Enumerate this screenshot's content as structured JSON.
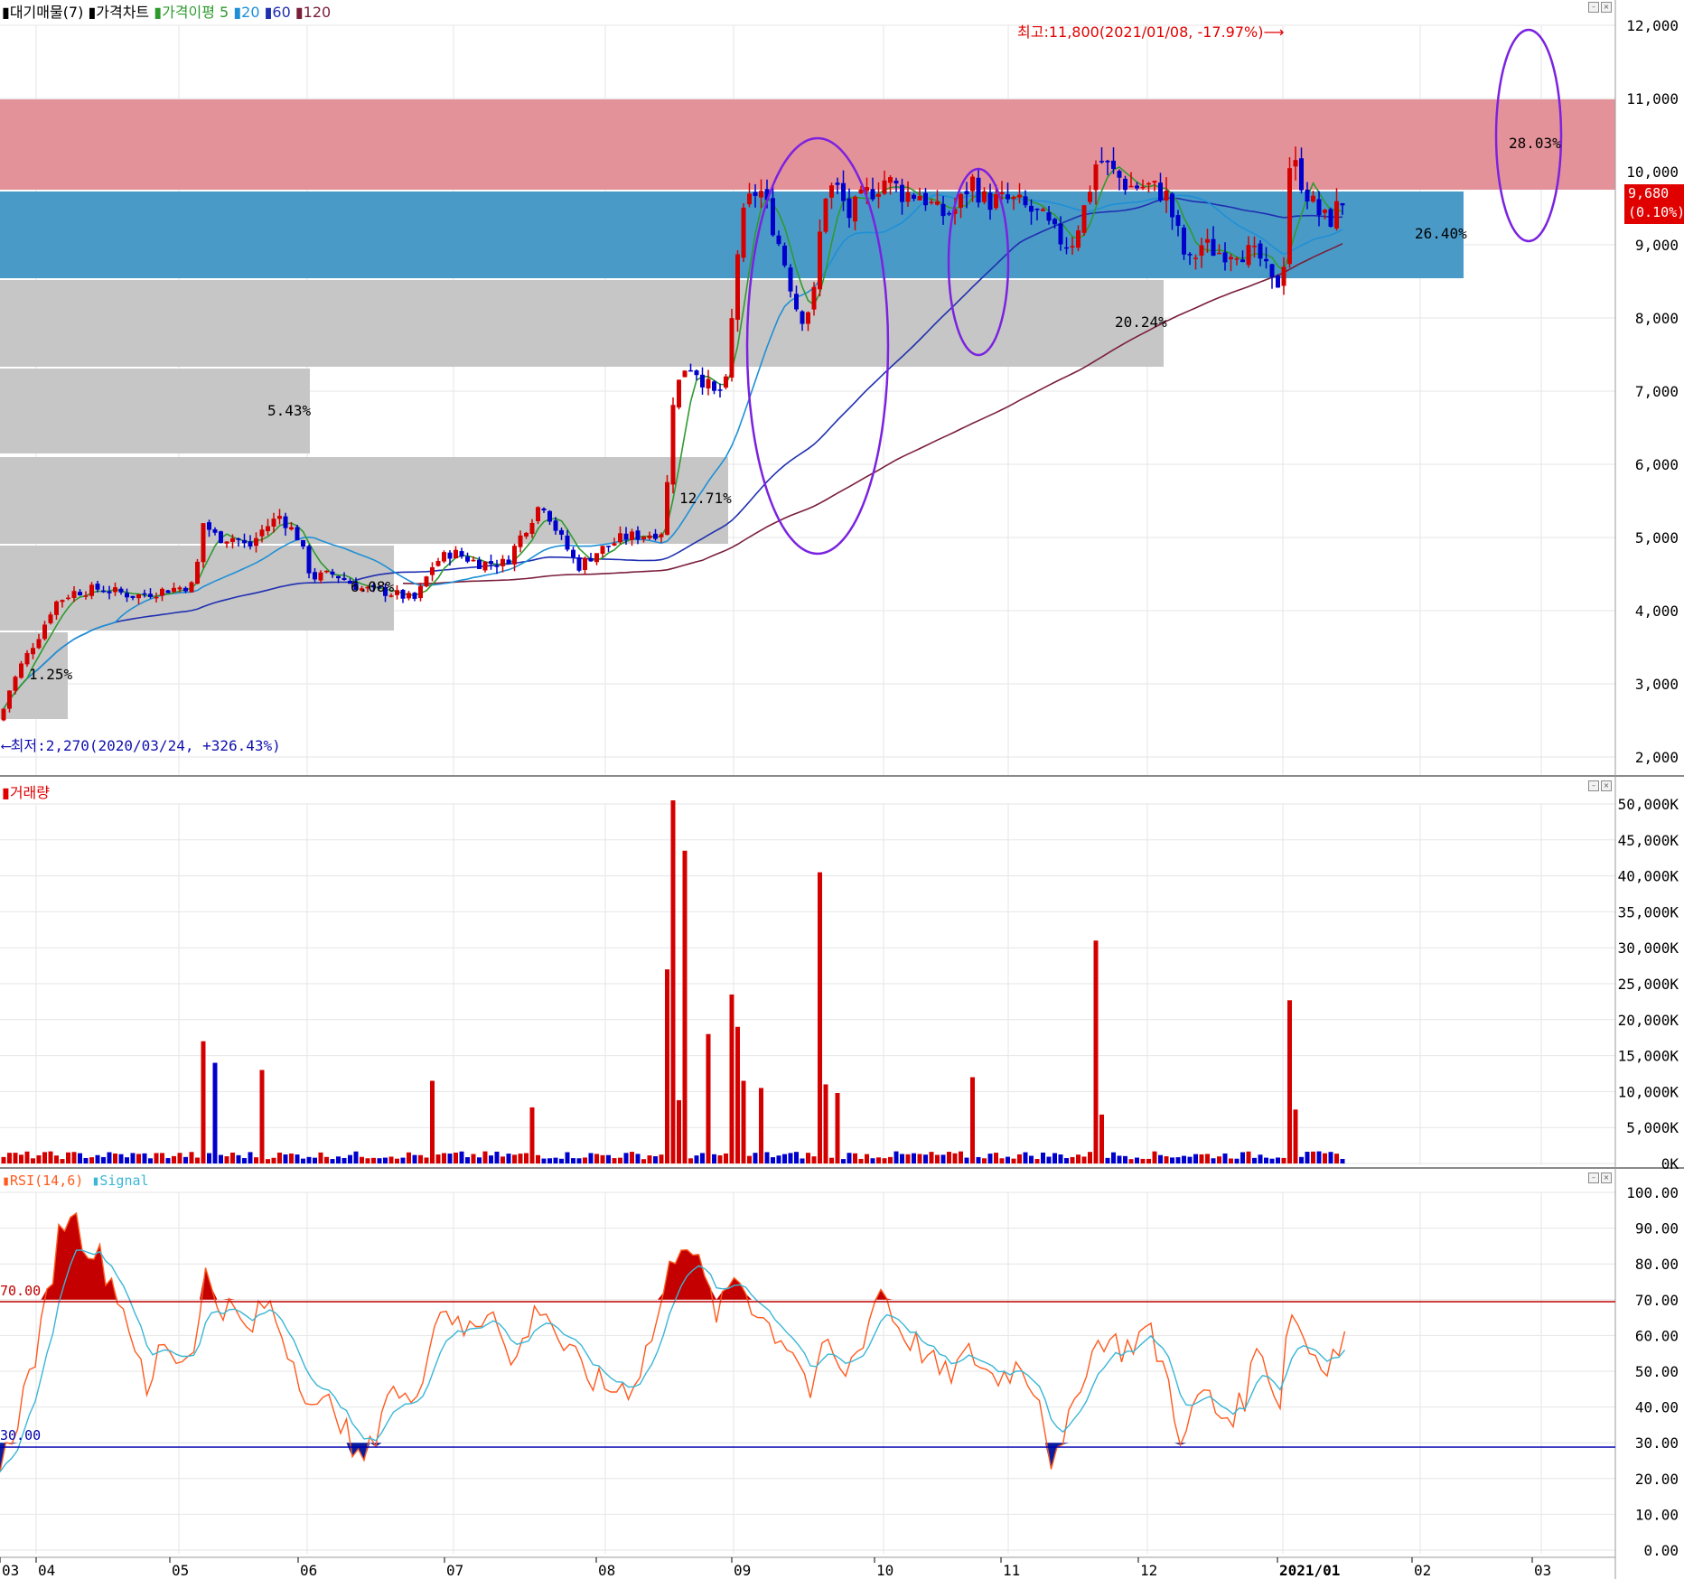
{
  "price_panel": {
    "legend": [
      {
        "label": "대기매물(7)",
        "color": "#000000"
      },
      {
        "label": "가격차트",
        "color": "#000000"
      },
      {
        "label": "가격이평",
        "color": "#2e9a2e"
      },
      {
        "label": "5",
        "color": "#2e9a2e"
      },
      {
        "label": "20",
        "color": "#1e90d6"
      },
      {
        "label": "60",
        "color": "#1f2fb0"
      },
      {
        "label": "120",
        "color": "#7a1e3a"
      }
    ],
    "y_ticks": [
      "12,000",
      "11,000",
      "10,000",
      "9,000",
      "8,000",
      "7,000",
      "6,000",
      "5,000",
      "4,000",
      "3,000",
      "2,000"
    ],
    "high_note": "최고:11,800(2021/01/08, -17.97%)⟶",
    "low_note": "⟵최저:2,270(2020/03/24, +326.43%)",
    "current_price": "9,680",
    "current_change": "(0.10%)",
    "supply_zones": [
      {
        "label": "1.25%"
      },
      {
        "label": "6.08%"
      },
      {
        "label": "12.71%"
      },
      {
        "label": "5.43%"
      },
      {
        "label": "20.24%"
      },
      {
        "label": "26.40%"
      },
      {
        "label": "28.03%"
      }
    ]
  },
  "volume_panel": {
    "legend": "거래량",
    "y_ticks": [
      "50,000K",
      "45,000K",
      "40,000K",
      "35,000K",
      "30,000K",
      "25,000K",
      "20,000K",
      "15,000K",
      "10,000K",
      "5,000K",
      "0K"
    ]
  },
  "rsi_panel": {
    "legend_rsi": "RSI(14,6)",
    "legend_signal": "Signal",
    "y_ticks": [
      "100.00",
      "90.00",
      "80.00",
      "70.00",
      "60.00",
      "50.00",
      "40.00",
      "30.00",
      "20.00",
      "10.00",
      "0.00"
    ],
    "overbought_label": "70.00",
    "oversold_label": "30.00"
  },
  "x_axis": [
    "03",
    "04",
    "05",
    "06",
    "07",
    "08",
    "09",
    "10",
    "11",
    "12",
    "2021/01",
    "02",
    "03"
  ],
  "colors": {
    "up": "#d40000",
    "down": "#0000cc",
    "ma5": "#2e9a2e",
    "ma20": "#1e90d6",
    "ma60": "#1f2fb0",
    "ma120": "#7a1e3a",
    "rsi": "#ff5a1e",
    "signal": "#3ab6d6"
  },
  "chart_data": {
    "type": "candlestick",
    "price_anchors": [
      {
        "x": 0,
        "v": 2500
      },
      {
        "x": 10,
        "v": 2900
      },
      {
        "x": 25,
        "v": 3300
      },
      {
        "x": 45,
        "v": 3700
      },
      {
        "x": 60,
        "v": 4100
      },
      {
        "x": 80,
        "v": 4250
      },
      {
        "x": 110,
        "v": 4300
      },
      {
        "x": 150,
        "v": 4200
      },
      {
        "x": 190,
        "v": 4300
      },
      {
        "x": 215,
        "v": 4350
      },
      {
        "x": 225,
        "v": 5200
      },
      {
        "x": 240,
        "v": 5000
      },
      {
        "x": 260,
        "v": 5000
      },
      {
        "x": 275,
        "v": 4850
      },
      {
        "x": 290,
        "v": 5100
      },
      {
        "x": 310,
        "v": 5300
      },
      {
        "x": 330,
        "v": 5000
      },
      {
        "x": 345,
        "v": 4450
      },
      {
        "x": 370,
        "v": 4500
      },
      {
        "x": 400,
        "v": 4300
      },
      {
        "x": 430,
        "v": 4250
      },
      {
        "x": 460,
        "v": 4150
      },
      {
        "x": 480,
        "v": 4650
      },
      {
        "x": 500,
        "v": 4800
      },
      {
        "x": 530,
        "v": 4650
      },
      {
        "x": 560,
        "v": 4650
      },
      {
        "x": 580,
        "v": 5100
      },
      {
        "x": 600,
        "v": 5500
      },
      {
        "x": 620,
        "v": 5000
      },
      {
        "x": 640,
        "v": 4600
      },
      {
        "x": 660,
        "v": 4800
      },
      {
        "x": 690,
        "v": 5000
      },
      {
        "x": 720,
        "v": 5050
      },
      {
        "x": 735,
        "v": 5100
      },
      {
        "x": 745,
        "v": 6900
      },
      {
        "x": 760,
        "v": 7400
      },
      {
        "x": 770,
        "v": 7300
      },
      {
        "x": 790,
        "v": 6950
      },
      {
        "x": 805,
        "v": 7100
      },
      {
        "x": 815,
        "v": 8800
      },
      {
        "x": 825,
        "v": 9500
      },
      {
        "x": 840,
        "v": 9800
      },
      {
        "x": 855,
        "v": 9300
      },
      {
        "x": 870,
        "v": 8700
      },
      {
        "x": 885,
        "v": 8000
      },
      {
        "x": 900,
        "v": 8200
      },
      {
        "x": 912,
        "v": 9700
      },
      {
        "x": 925,
        "v": 9800
      },
      {
        "x": 940,
        "v": 9400
      },
      {
        "x": 960,
        "v": 9700
      },
      {
        "x": 980,
        "v": 9900
      },
      {
        "x": 1000,
        "v": 9700
      },
      {
        "x": 1020,
        "v": 9700
      },
      {
        "x": 1040,
        "v": 9400
      },
      {
        "x": 1060,
        "v": 9500
      },
      {
        "x": 1075,
        "v": 9900
      },
      {
        "x": 1090,
        "v": 9600
      },
      {
        "x": 1120,
        "v": 9600
      },
      {
        "x": 1150,
        "v": 9400
      },
      {
        "x": 1170,
        "v": 9100
      },
      {
        "x": 1185,
        "v": 9000
      },
      {
        "x": 1200,
        "v": 9500
      },
      {
        "x": 1215,
        "v": 10200
      },
      {
        "x": 1230,
        "v": 10000
      },
      {
        "x": 1250,
        "v": 9800
      },
      {
        "x": 1270,
        "v": 9800
      },
      {
        "x": 1290,
        "v": 9700
      },
      {
        "x": 1300,
        "v": 9300
      },
      {
        "x": 1315,
        "v": 8700
      },
      {
        "x": 1330,
        "v": 9000
      },
      {
        "x": 1350,
        "v": 8900
      },
      {
        "x": 1370,
        "v": 8950
      },
      {
        "x": 1395,
        "v": 8800
      },
      {
        "x": 1410,
        "v": 8400
      },
      {
        "x": 1420,
        "v": 8600
      },
      {
        "x": 1428,
        "v": 10200
      },
      {
        "x": 1440,
        "v": 9900
      },
      {
        "x": 1455,
        "v": 9500
      },
      {
        "x": 1470,
        "v": 9300
      },
      {
        "x": 1480,
        "v": 9500
      },
      {
        "x": 1490,
        "v": 9680
      }
    ],
    "price_range": [
      2000,
      12000
    ],
    "volume_range_k": [
      0,
      50000
    ],
    "volume_spikes_k": [
      {
        "x": 224,
        "v": 17000
      },
      {
        "x": 236,
        "v": 14000
      },
      {
        "x": 292,
        "v": 13000
      },
      {
        "x": 478,
        "v": 11500
      },
      {
        "x": 590,
        "v": 7800
      },
      {
        "x": 738,
        "v": 27000
      },
      {
        "x": 744,
        "v": 50500
      },
      {
        "x": 752,
        "v": 8800
      },
      {
        "x": 758,
        "v": 43500
      },
      {
        "x": 782,
        "v": 18000
      },
      {
        "x": 812,
        "v": 23500
      },
      {
        "x": 818,
        "v": 19000
      },
      {
        "x": 824,
        "v": 11500
      },
      {
        "x": 845,
        "v": 10500
      },
      {
        "x": 906,
        "v": 40500
      },
      {
        "x": 912,
        "v": 11000
      },
      {
        "x": 925,
        "v": 9800
      },
      {
        "x": 1074,
        "v": 12000
      },
      {
        "x": 1216,
        "v": 31000
      },
      {
        "x": 1222,
        "v": 6800
      },
      {
        "x": 1428,
        "v": 22700
      },
      {
        "x": 1434,
        "v": 7500
      }
    ],
    "rsi_anchors": [
      {
        "x": 0,
        "v": 22
      },
      {
        "x": 20,
        "v": 38
      },
      {
        "x": 45,
        "v": 60
      },
      {
        "x": 65,
        "v": 88
      },
      {
        "x": 78,
        "v": 96
      },
      {
        "x": 90,
        "v": 88
      },
      {
        "x": 110,
        "v": 82
      },
      {
        "x": 130,
        "v": 72
      },
      {
        "x": 150,
        "v": 58
      },
      {
        "x": 162,
        "v": 41
      },
      {
        "x": 180,
        "v": 60
      },
      {
        "x": 200,
        "v": 52
      },
      {
        "x": 220,
        "v": 62
      },
      {
        "x": 228,
        "v": 78
      },
      {
        "x": 240,
        "v": 70
      },
      {
        "x": 260,
        "v": 66
      },
      {
        "x": 275,
        "v": 60
      },
      {
        "x": 295,
        "v": 70
      },
      {
        "x": 310,
        "v": 62
      },
      {
        "x": 330,
        "v": 50
      },
      {
        "x": 350,
        "v": 38
      },
      {
        "x": 370,
        "v": 42
      },
      {
        "x": 395,
        "v": 24
      },
      {
        "x": 410,
        "v": 28
      },
      {
        "x": 430,
        "v": 46
      },
      {
        "x": 450,
        "v": 40
      },
      {
        "x": 470,
        "v": 52
      },
      {
        "x": 490,
        "v": 71
      },
      {
        "x": 510,
        "v": 60
      },
      {
        "x": 530,
        "v": 64
      },
      {
        "x": 548,
        "v": 70
      },
      {
        "x": 565,
        "v": 50
      },
      {
        "x": 585,
        "v": 62
      },
      {
        "x": 600,
        "v": 70
      },
      {
        "x": 620,
        "v": 58
      },
      {
        "x": 645,
        "v": 50
      },
      {
        "x": 670,
        "v": 45
      },
      {
        "x": 700,
        "v": 46
      },
      {
        "x": 725,
        "v": 62
      },
      {
        "x": 745,
        "v": 82
      },
      {
        "x": 758,
        "v": 89
      },
      {
        "x": 775,
        "v": 78
      },
      {
        "x": 795,
        "v": 65
      },
      {
        "x": 815,
        "v": 78
      },
      {
        "x": 830,
        "v": 70
      },
      {
        "x": 850,
        "v": 63
      },
      {
        "x": 880,
        "v": 56
      },
      {
        "x": 900,
        "v": 42
      },
      {
        "x": 915,
        "v": 60
      },
      {
        "x": 930,
        "v": 48
      },
      {
        "x": 950,
        "v": 56
      },
      {
        "x": 975,
        "v": 74
      },
      {
        "x": 995,
        "v": 62
      },
      {
        "x": 1020,
        "v": 56
      },
      {
        "x": 1045,
        "v": 48
      },
      {
        "x": 1075,
        "v": 55
      },
      {
        "x": 1100,
        "v": 48
      },
      {
        "x": 1130,
        "v": 52
      },
      {
        "x": 1150,
        "v": 44
      },
      {
        "x": 1165,
        "v": 24
      },
      {
        "x": 1175,
        "v": 26
      },
      {
        "x": 1195,
        "v": 48
      },
      {
        "x": 1220,
        "v": 60
      },
      {
        "x": 1245,
        "v": 56
      },
      {
        "x": 1270,
        "v": 62
      },
      {
        "x": 1290,
        "v": 50
      },
      {
        "x": 1310,
        "v": 29
      },
      {
        "x": 1330,
        "v": 46
      },
      {
        "x": 1350,
        "v": 37
      },
      {
        "x": 1375,
        "v": 40
      },
      {
        "x": 1395,
        "v": 60
      },
      {
        "x": 1415,
        "v": 38
      },
      {
        "x": 1428,
        "v": 69
      },
      {
        "x": 1445,
        "v": 58
      },
      {
        "x": 1465,
        "v": 52
      },
      {
        "x": 1490,
        "v": 59
      }
    ]
  }
}
